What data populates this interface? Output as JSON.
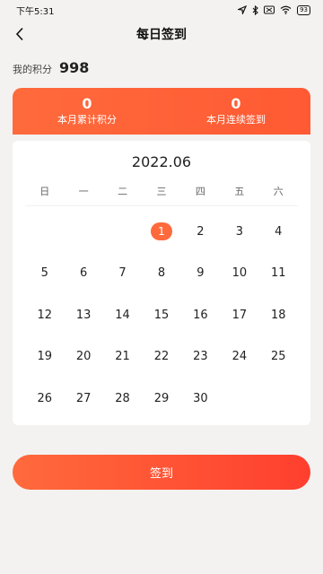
{
  "status_bar": {
    "time": "下午5:31",
    "battery": "93"
  },
  "header": {
    "title": "每日签到"
  },
  "points": {
    "label": "我的积分",
    "value": "998"
  },
  "stats": [
    {
      "value": "0",
      "label": "本月累计积分"
    },
    {
      "value": "0",
      "label": "本月连续签到"
    }
  ],
  "calendar": {
    "month": "2022.06",
    "weekdays": [
      "日",
      "一",
      "二",
      "三",
      "四",
      "五",
      "六"
    ],
    "leading_blanks": 3,
    "days": [
      "1",
      "2",
      "3",
      "4",
      "5",
      "6",
      "7",
      "8",
      "9",
      "10",
      "11",
      "12",
      "13",
      "14",
      "15",
      "16",
      "17",
      "18",
      "19",
      "20",
      "21",
      "22",
      "23",
      "24",
      "25",
      "26",
      "27",
      "28",
      "29",
      "30"
    ],
    "highlighted_day": "1"
  },
  "signin_button": {
    "label": "签到"
  },
  "colors": {
    "accent": "#ff6a3c",
    "accent_end": "#ff3f2e",
    "background": "#f3f2f0"
  }
}
